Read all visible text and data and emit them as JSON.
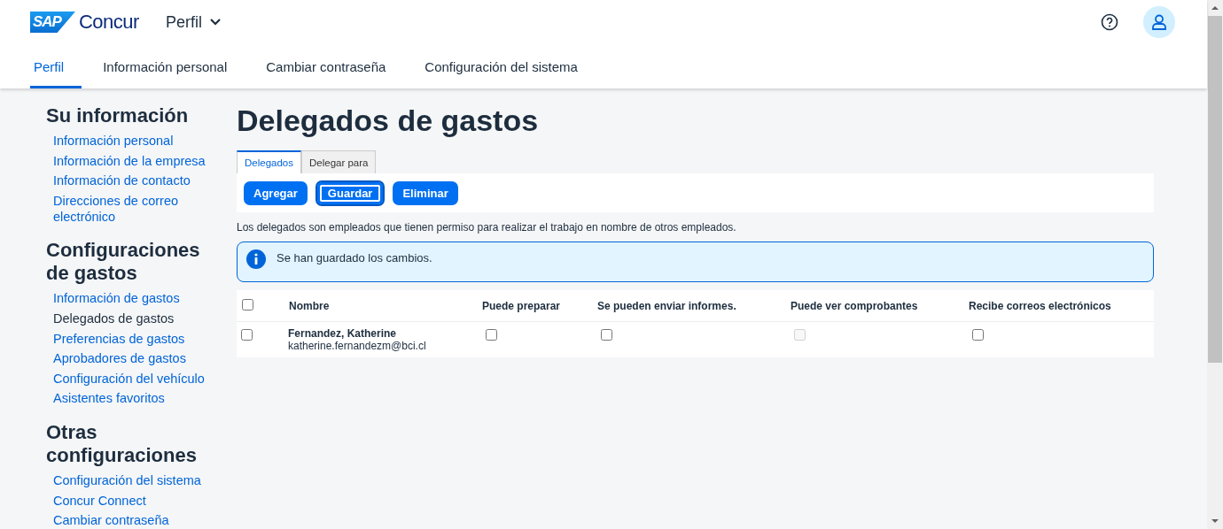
{
  "header": {
    "logo_mark": "SAP",
    "logo_text": "Concur",
    "menu": "Perfil"
  },
  "nav_tabs": [
    {
      "label": "Perfil",
      "selected": true
    },
    {
      "label": "Información personal",
      "selected": false
    },
    {
      "label": "Cambiar contraseña",
      "selected": false
    },
    {
      "label": "Configuración del sistema",
      "selected": false
    }
  ],
  "sidebar": [
    {
      "title": "Su información",
      "items": [
        {
          "label": "Información personal",
          "selected": false
        },
        {
          "label": "Información de la empresa",
          "selected": false
        },
        {
          "label": "Información de contacto",
          "selected": false
        },
        {
          "label": "Direcciones de correo electrónico",
          "selected": false
        }
      ]
    },
    {
      "title": "Configuraciones de gastos",
      "items": [
        {
          "label": "Información de gastos",
          "selected": false
        },
        {
          "label": "Delegados de gastos",
          "selected": true
        },
        {
          "label": "Preferencias de gastos",
          "selected": false
        },
        {
          "label": "Aprobadores de gastos",
          "selected": false
        },
        {
          "label": "Configuración del vehículo",
          "selected": false
        },
        {
          "label": "Asistentes favoritos",
          "selected": false
        }
      ]
    },
    {
      "title": "Otras configuraciones",
      "items": [
        {
          "label": "Configuración del sistema",
          "selected": false
        },
        {
          "label": "Concur Connect",
          "selected": false
        },
        {
          "label": "Cambiar contraseña",
          "selected": false
        }
      ]
    }
  ],
  "page_title": "Delegados de gastos",
  "tabs": [
    {
      "label": "Delegados",
      "selected": true
    },
    {
      "label": "Delegar para",
      "selected": false
    }
  ],
  "buttons": [
    {
      "label": "Agregar",
      "focused": false
    },
    {
      "label": "Guardar",
      "focused": true
    },
    {
      "label": "Eliminar",
      "focused": false
    }
  ],
  "description": "Los delegados son empleados que tienen permiso para realizar el trabajo en nombre de otros empleados.",
  "message": "Se han guardado los cambios.",
  "table": {
    "select_all_checked": false,
    "columns": [
      "Nombre",
      "Puede preparar",
      "Se pueden enviar informes.",
      "Puede ver comprobantes",
      "Recibe correos electrónicos"
    ],
    "rows": [
      {
        "checked": false,
        "name": "Fernandez, Katherine",
        "email": "katherine.fernandezm@bci.cl",
        "permissions": [
          {
            "checked": false,
            "disabled": false
          },
          {
            "checked": false,
            "disabled": false
          },
          {
            "checked": false,
            "disabled": true
          },
          {
            "checked": false,
            "disabled": false
          }
        ]
      }
    ]
  }
}
